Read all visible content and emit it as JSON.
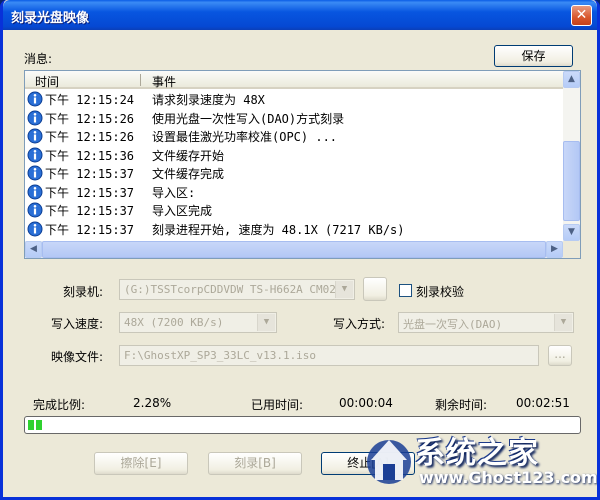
{
  "window": {
    "title": "刻录光盘映像",
    "close_glyph": "✕"
  },
  "messages": {
    "label": "消息:",
    "save_button": "保存",
    "columns": [
      "时间",
      "事件"
    ],
    "rows": [
      {
        "time": "下午 12:15:24",
        "event": "请求刻录速度为 48X"
      },
      {
        "time": "下午 12:15:26",
        "event": "使用光盘一次性写入(DAO)方式刻录"
      },
      {
        "time": "下午 12:15:26",
        "event": "设置最佳激光功率校准(OPC) ..."
      },
      {
        "time": "下午 12:15:36",
        "event": "文件缓存开始"
      },
      {
        "time": "下午 12:15:37",
        "event": "文件缓存完成"
      },
      {
        "time": "下午 12:15:37",
        "event": "导入区:"
      },
      {
        "time": "下午 12:15:37",
        "event": "导入区完成"
      },
      {
        "time": "下午 12:15:37",
        "event": "刻录进程开始, 速度为 48.1X (7217 KB/s)"
      }
    ],
    "row_icon": "info-icon"
  },
  "settings": {
    "recorder_label": "刻录机:",
    "recorder_value": "(G:)TSSTcorpCDDVDW TS-H662A CM02",
    "verify_label": "刻录校验",
    "speed_label": "写入速度:",
    "speed_value": "48X (7200 KB/s)",
    "mode_label": "写入方式:",
    "mode_value": "光盘一次写入(DAO)",
    "image_label": "映像文件:",
    "image_value": "F:\\GhostXP_SP3_33LC_v13.1.iso",
    "browse_label": "..."
  },
  "status": {
    "percent_label": "完成比例:",
    "percent_value": "2.28%",
    "elapsed_label": "已用时间:",
    "elapsed_value": "00:00:04",
    "remaining_label": "剩余时间:",
    "remaining_value": "00:02:51",
    "progress_fraction": 0.0228
  },
  "buttons": {
    "erase": "擦除[E]",
    "burn": "刻录[B]",
    "finish": "终止[A]"
  },
  "watermark": {
    "text": "系统之家",
    "url": "www.Ghost123.com"
  },
  "colors": {
    "title_bar": "#0548d3",
    "progress": "#2fd12f",
    "info_icon": "#2a6fd6"
  }
}
